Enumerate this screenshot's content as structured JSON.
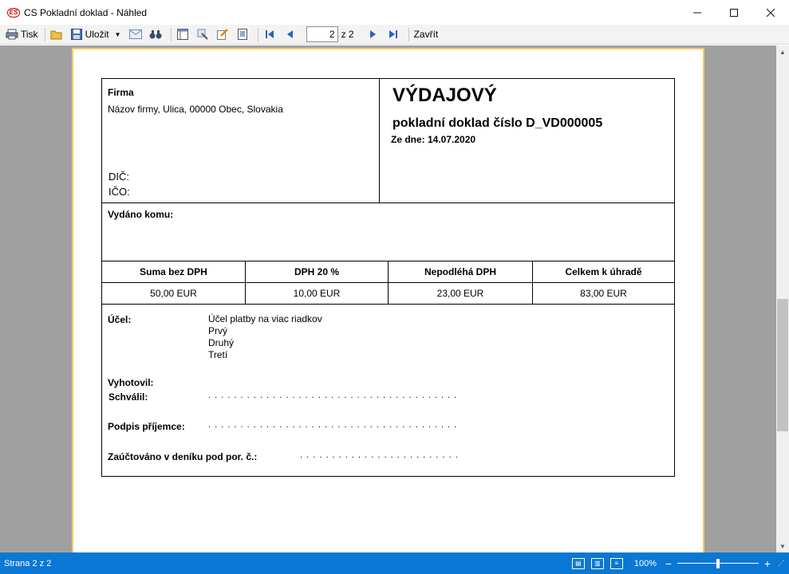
{
  "window": {
    "icon_text": "ES",
    "title": "CS Pokladní doklad - Náhled"
  },
  "toolbar": {
    "print_label": "Tisk",
    "save_label": "Uložit",
    "page_current": "2",
    "page_total": "z 2",
    "close_label": "Zavřít"
  },
  "document": {
    "firm_label": "Firma",
    "firm_address": "Názov firmy, Ulica, 00000 Obec, Slovakia",
    "dic_label": "DIČ:",
    "ico_label": "IČO:",
    "doc_type": "VÝDAJOVÝ",
    "doc_subtitle": "pokladní doklad číslo D_VD000005",
    "doc_date": "Ze dne: 14.07.2020",
    "issued_to_label": "Vydáno komu:",
    "sums": {
      "headers": [
        "Suma bez DPH",
        "DPH 20 %",
        "Nepodléhá DPH",
        "Celkem k úhradě"
      ],
      "values": [
        "50,00 EUR",
        "10,00 EUR",
        "23,00 EUR",
        "83,00 EUR"
      ]
    },
    "purpose_label": "Účel:",
    "purpose_lines": [
      "Účel platby na viac riadkov",
      "Prvý",
      "Druhý",
      "Tretí"
    ],
    "made_by_label": "Vyhotovil:",
    "approved_label": "Schválil:",
    "approved_dots": ". . . . . . . . . . . . . . . . . . . . . . . . . . . . . . . . . . . . . . .",
    "receiver_label": "Podpis příjemce:",
    "receiver_dots": ". . . . . . . . . . . . . . . . . . . . . . . . . . . . . . . . . . . . . . .",
    "booked_label": "Zaúčtováno v deníku pod por. č.:",
    "booked_dots": ". . . . . . . . . . . . . . . . . . . . . . . . ."
  },
  "statusbar": {
    "page_status": "Strana 2 z 2",
    "zoom": "100%",
    "zoom_level_fraction": 0.5
  }
}
